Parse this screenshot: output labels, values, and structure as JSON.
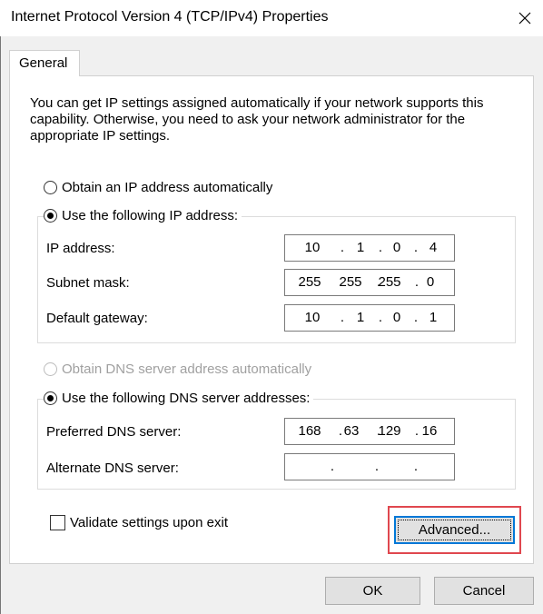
{
  "window": {
    "title": "Internet Protocol Version 4 (TCP/IPv4) Properties"
  },
  "tabs": [
    {
      "label": "General"
    }
  ],
  "description": "You can get IP settings assigned automatically if your network supports this capability. Otherwise, you need to ask your network administrator for the appropriate IP settings.",
  "ip": {
    "auto_label": "Obtain an IP address automatically",
    "manual_label": "Use the following IP address:",
    "selected": "manual",
    "fields": [
      {
        "label": "IP address:",
        "octets": [
          "10",
          "1",
          "0",
          "4"
        ]
      },
      {
        "label": "Subnet mask:",
        "octets": [
          "255",
          "255",
          "255",
          "0"
        ]
      },
      {
        "label": "Default gateway:",
        "octets": [
          "10",
          "1",
          "0",
          "1"
        ]
      }
    ]
  },
  "dns": {
    "auto_label": "Obtain DNS server address automatically",
    "manual_label": "Use the following DNS server addresses:",
    "selected": "manual",
    "fields": [
      {
        "label": "Preferred DNS server:",
        "octets": [
          "168",
          "63",
          "129",
          "16"
        ]
      },
      {
        "label": "Alternate DNS server:",
        "octets": [
          "",
          "",
          "",
          ""
        ]
      }
    ]
  },
  "validate": {
    "label": "Validate settings upon exit",
    "checked": false
  },
  "buttons": {
    "advanced": "Advanced...",
    "ok": "OK",
    "cancel": "Cancel"
  },
  "colors": {
    "highlight": "#e0474f",
    "focus_border": "#0078d7"
  }
}
